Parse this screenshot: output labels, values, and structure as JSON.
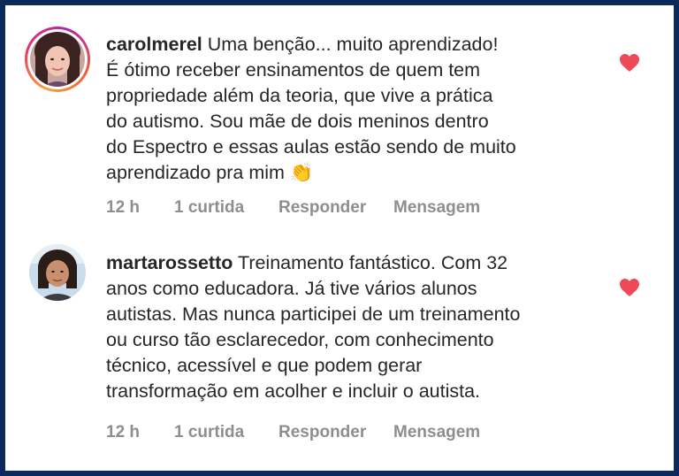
{
  "comments": [
    {
      "username": "carolmerel",
      "text": "Uma benção... muito aprendizado!\nÉ ótimo receber ensinamentos de quem tem\npropriedade além da teoria, que vive a prática\ndo autismo. Sou mãe de dois meninos dentro\ndo Espectro e essas aulas estão sendo de muito\naprendizado pra mim 👏",
      "time": "12 h",
      "likes": "1 curtida",
      "reply": "Responder",
      "message": "Mensagem",
      "liked": true
    },
    {
      "username": "martarossetto",
      "text": "Treinamento fantástico. Com 32\nanos como educadora. Já tive vários alunos\nautistas. Mas nunca participei de um treinamento\nou curso tão esclarecedor, com conhecimento\ntécnico, acessível e que podem gerar\ntransformação em acolher e incluir o autista.",
      "time": "12 h",
      "likes": "1 curtida",
      "reply": "Responder",
      "message": "Mensagem",
      "liked": true
    }
  ],
  "colors": {
    "frame": "#0b2a5b",
    "heart": "#ed4956",
    "meta": "#8e8e8e",
    "text": "#262626"
  }
}
